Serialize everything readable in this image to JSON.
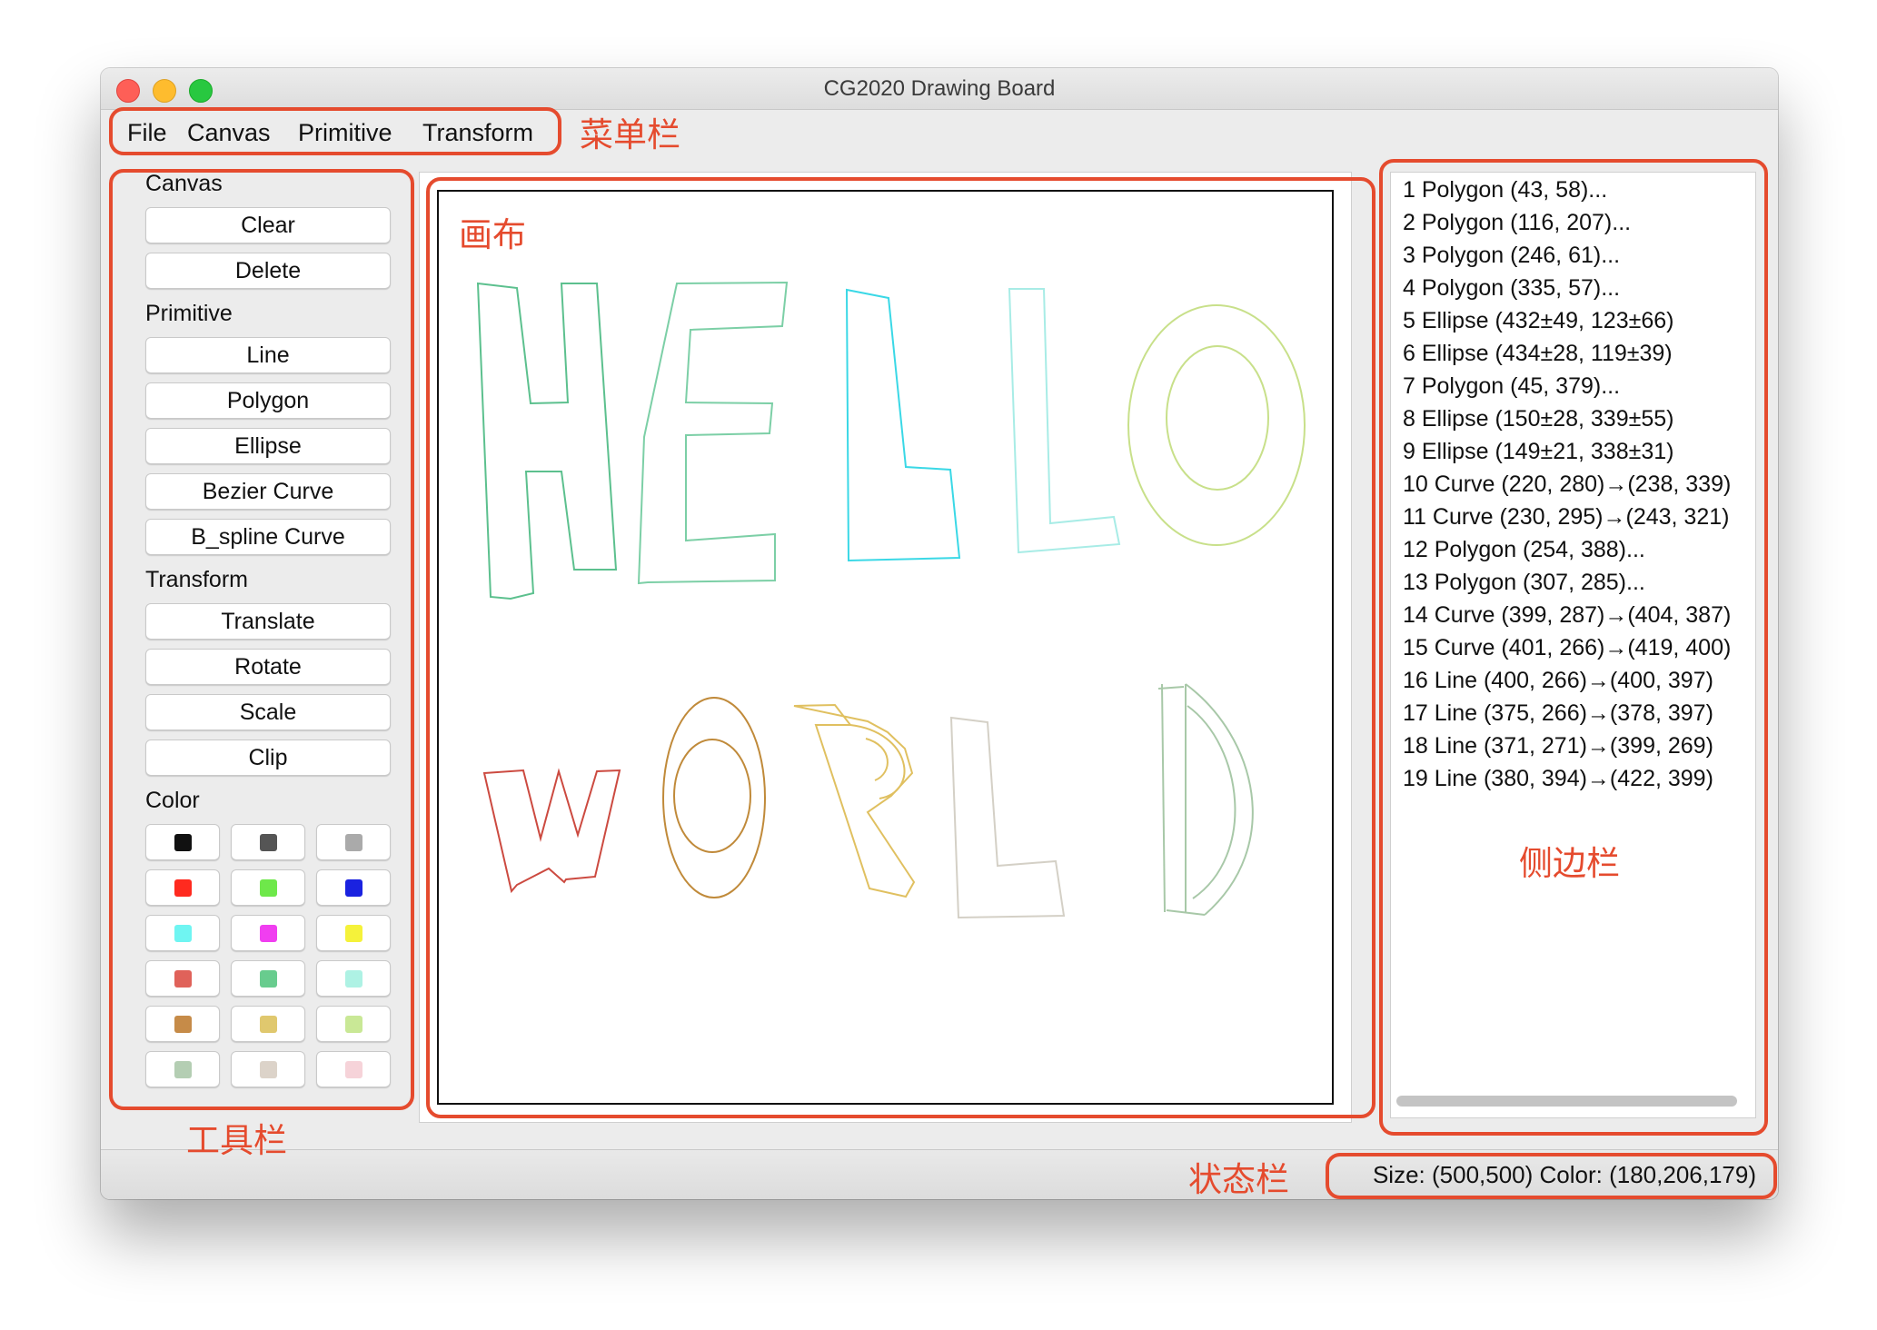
{
  "window": {
    "title": "CG2020 Drawing Board"
  },
  "menu": [
    "File",
    "Canvas",
    "Primitive",
    "Transform"
  ],
  "toolbar": {
    "canvas_label": "Canvas",
    "canvas_buttons": [
      "Clear",
      "Delete"
    ],
    "primitive_label": "Primitive",
    "primitive_buttons": [
      "Line",
      "Polygon",
      "Ellipse",
      "Bezier Curve",
      "B_spline Curve"
    ],
    "transform_label": "Transform",
    "transform_buttons": [
      "Translate",
      "Rotate",
      "Scale",
      "Clip"
    ],
    "color_label": "Color",
    "colors": [
      "#111111",
      "#555555",
      "#aaaaaa",
      "#ff2a1f",
      "#6ee84a",
      "#1a22e0",
      "#6ff5f2",
      "#f03ef0",
      "#f5f23a",
      "#e0625a",
      "#68cc8e",
      "#aef2e4",
      "#c68b48",
      "#e0c86e",
      "#c9e896",
      "#b4ceb3",
      "#dcd3c9",
      "#f6d3d9"
    ]
  },
  "shape_list": [
    "1 Polygon (43, 58)...",
    "2 Polygon (116, 207)...",
    "3 Polygon (246, 61)...",
    "4 Polygon (335, 57)...",
    "5 Ellipse (432±49, 123±66)",
    "6 Ellipse (434±28, 119±39)",
    "7 Polygon (45, 379)...",
    "8 Ellipse (150±28, 339±55)",
    "9 Ellipse (149±21, 338±31)",
    "10 Curve (220, 280)→(238, 339)",
    "11 Curve (230, 295)→(243, 321)",
    "12 Polygon (254, 388)...",
    "13 Polygon (307, 285)...",
    "14 Curve (399, 287)→(404, 387)",
    "15 Curve (401, 266)→(419, 400)",
    "16 Line (400, 266)→(400, 397)",
    "17 Line (375, 266)→(378, 397)",
    "18 Line (371, 271)→(399, 269)",
    "19 Line (380, 394)→(422, 399)"
  ],
  "status": {
    "text": "Size: (500,500)  Color: (180,206,179)"
  },
  "annotations": {
    "menubar": "菜单栏",
    "canvas": "画布",
    "toolbar": "工具栏",
    "sidebar": "侧边栏",
    "statusbar": "状态栏"
  },
  "drawing_colors": {
    "H": "#5cc08e",
    "E": "#7ccfa6",
    "L1": "#3ad8e6",
    "L2": "#a8ece6",
    "O_outer": "#c8e08a",
    "O_inner": "#c8e08a",
    "W": "#cc4a40",
    "O2": "#c08a3a",
    "R": "#e0c060",
    "L3": "#d4d0c6",
    "D": "#a8c8a8"
  }
}
